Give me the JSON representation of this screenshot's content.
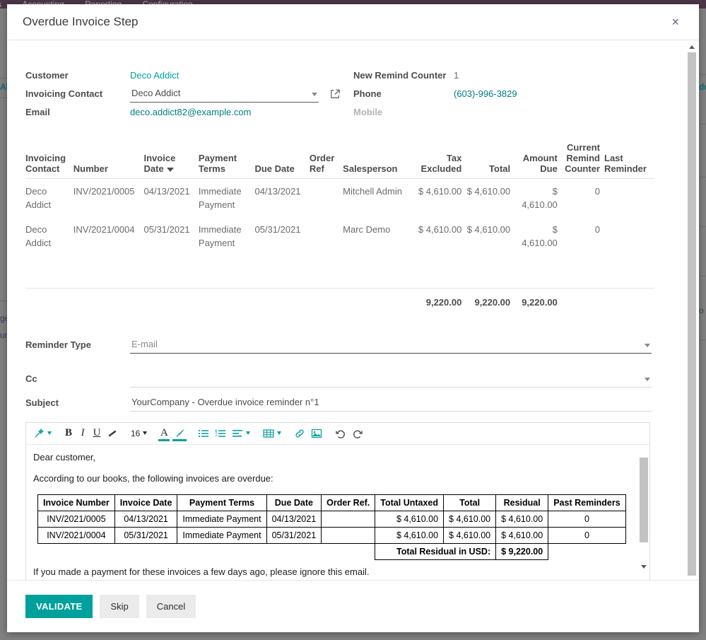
{
  "navbar": {
    "items": [
      "rs",
      "Accounting",
      "Reporting",
      "Configuration"
    ],
    "bg_color": "#4b3647"
  },
  "background": {
    "fragments": [
      "AD",
      "du",
      "ge",
      "ur",
      "o"
    ]
  },
  "modal": {
    "title": "Overdue Invoice Step",
    "close_label": "×"
  },
  "header_form": {
    "left": [
      {
        "label": "Customer",
        "value": "Deco Addict",
        "type": "link"
      },
      {
        "label": "Invoicing Contact",
        "value": "Deco Addict",
        "type": "combo"
      },
      {
        "label": "Email",
        "value": "deco.addict82@example.com",
        "type": "link"
      }
    ],
    "right": [
      {
        "label": "New Remind Counter",
        "value": "1",
        "type": "text"
      },
      {
        "label": "Phone",
        "value": "(603)-996-3829",
        "type": "link"
      },
      {
        "label": "Mobile",
        "value": "",
        "type": "muted"
      }
    ],
    "open_record_icon": "external-link-icon"
  },
  "invoice_table": {
    "columns": [
      {
        "key": "contact",
        "label": "Invoicing Contact",
        "align": "left"
      },
      {
        "key": "number",
        "label": "Number",
        "align": "left"
      },
      {
        "key": "inv_date",
        "label": "Invoice Date",
        "align": "left",
        "sorted": true,
        "sort_dir": "desc"
      },
      {
        "key": "terms",
        "label": "Payment Terms",
        "align": "left"
      },
      {
        "key": "due_date",
        "label": "Due Date",
        "align": "left"
      },
      {
        "key": "order_ref",
        "label": "Order Ref",
        "align": "left"
      },
      {
        "key": "sales",
        "label": "Salesperson",
        "align": "left"
      },
      {
        "key": "tax_excl",
        "label": "Tax Excluded",
        "align": "right"
      },
      {
        "key": "total",
        "label": "Total",
        "align": "right"
      },
      {
        "key": "amt_due",
        "label": "Amount Due",
        "align": "right"
      },
      {
        "key": "cur_rem",
        "label": "Current Remind Counter",
        "align": "right"
      },
      {
        "key": "last_rem",
        "label": "Last Reminder",
        "align": "left"
      }
    ],
    "rows": [
      {
        "contact": "Deco Addict",
        "number": "INV/2021/0005",
        "inv_date": "04/13/2021",
        "terms": "Immediate Payment",
        "due_date": "04/13/2021",
        "order_ref": "",
        "sales": "Mitchell Admin",
        "tax_excl": "$ 4,610.00",
        "total": "$ 4,610.00",
        "amt_due": "$ 4,610.00",
        "cur_rem": "0",
        "last_rem": ""
      },
      {
        "contact": "Deco Addict",
        "number": "INV/2021/0004",
        "inv_date": "05/31/2021",
        "terms": "Immediate Payment",
        "due_date": "05/31/2021",
        "order_ref": "",
        "sales": "Marc Demo",
        "tax_excl": "$ 4,610.00",
        "total": "$ 4,610.00",
        "amt_due": "$ 4,610.00",
        "cur_rem": "0",
        "last_rem": ""
      }
    ],
    "totals": {
      "tax_excl": "9,220.00",
      "total": "9,220.00",
      "amt_due": "9,220.00"
    }
  },
  "lower_fields": {
    "reminder_type": {
      "label": "Reminder Type",
      "value": "E-mail"
    },
    "cc": {
      "label": "Cc",
      "value": ""
    },
    "subject": {
      "label": "Subject",
      "value": "YourCompany - Overdue invoice reminder n°1"
    }
  },
  "editor": {
    "toolbar": [
      {
        "name": "style-magicwand-icon",
        "glyph": "wand",
        "caret": true,
        "dark": false
      },
      {
        "name": "bold-icon",
        "glyph": "B",
        "caret": false,
        "dark": true
      },
      {
        "name": "italic-icon",
        "glyph": "I",
        "caret": false,
        "dark": true
      },
      {
        "name": "underline-icon",
        "glyph": "U",
        "caret": false,
        "dark": true
      },
      {
        "name": "strikethrough-icon",
        "glyph": "strike",
        "caret": false,
        "dark": true
      },
      {
        "name": "font-size-selector",
        "glyph": "16",
        "caret": true,
        "dark": true
      },
      {
        "name": "font-color-icon",
        "glyph": "A",
        "caret": false,
        "dark": true,
        "active_underline": "#00a09d"
      },
      {
        "name": "background-color-icon",
        "glyph": "brush",
        "caret": false,
        "dark": false,
        "active_underline": "#00a09d"
      },
      {
        "name": "unordered-list-icon",
        "glyph": "ul",
        "caret": false,
        "dark": false
      },
      {
        "name": "ordered-list-icon",
        "glyph": "ol",
        "caret": false,
        "dark": false
      },
      {
        "name": "align-icon",
        "glyph": "align",
        "caret": true,
        "dark": false
      },
      {
        "name": "table-icon",
        "glyph": "table",
        "caret": true,
        "dark": false
      },
      {
        "name": "link-icon",
        "glyph": "link",
        "caret": false,
        "dark": false
      },
      {
        "name": "image-icon",
        "glyph": "image",
        "caret": false,
        "dark": false
      },
      {
        "name": "undo-icon",
        "glyph": "undo",
        "caret": false,
        "dark": false
      },
      {
        "name": "redo-icon",
        "glyph": "redo",
        "caret": false,
        "dark": false
      }
    ],
    "font_size": "16",
    "body": {
      "greeting": "Dear customer,",
      "intro": "According to our books, the following invoices are overdue:",
      "table": {
        "headers": [
          "Invoice Number",
          "Invoice Date",
          "Payment Terms",
          "Due Date",
          "Order Ref.",
          "Total Untaxed",
          "Total",
          "Residual",
          "Past Reminders"
        ],
        "rows": [
          [
            "INV/2021/0005",
            "04/13/2021",
            "Immediate Payment",
            "04/13/2021",
            "",
            "$ 4,610.00",
            "$ 4,610.00",
            "$ 4,610.00",
            "0"
          ],
          [
            "INV/2021/0004",
            "05/31/2021",
            "Immediate Payment",
            "05/31/2021",
            "",
            "$ 4,610.00",
            "$ 4,610.00",
            "$ 4,610.00",
            "0"
          ]
        ],
        "total_label": "Total Residual in USD:",
        "total_value": "$ 9,220.00"
      },
      "footer": "If you made a payment for these invoices a few days ago, please ignore this email."
    }
  },
  "footer_buttons": {
    "validate": "VALIDATE",
    "skip": "Skip",
    "cancel": "Cancel"
  },
  "colors": {
    "accent": "#00a09d",
    "navbar": "#4b3647",
    "link": "#00a09d"
  }
}
